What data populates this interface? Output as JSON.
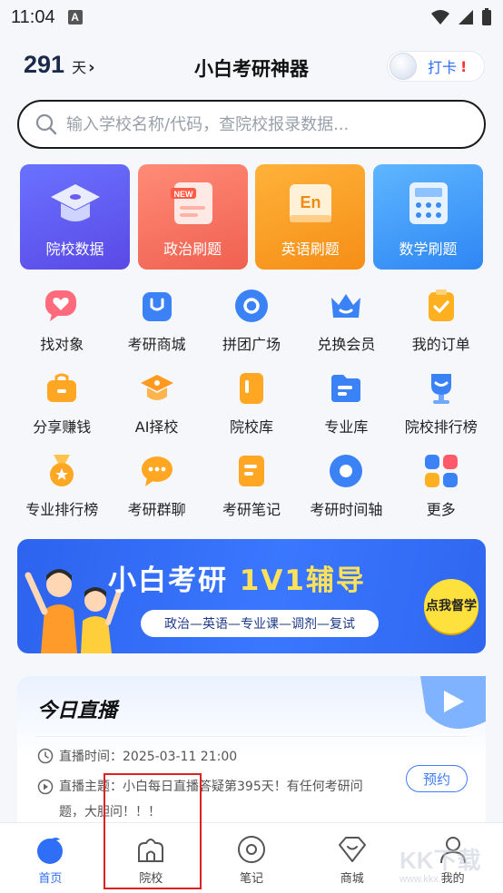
{
  "status_bar": {
    "time": "11:04",
    "notif_letter": "A"
  },
  "header": {
    "days_count": "291",
    "days_unit": "天",
    "days_chevron": "›",
    "title": "小白考研神器",
    "checkin_label": "打卡",
    "checkin_alert": "!"
  },
  "search": {
    "placeholder": "输入学校名称/代码，查院校报录数据..."
  },
  "big_cards": [
    {
      "label": "院校数据",
      "icon": "graduation-cap-icon"
    },
    {
      "label": "政治刷题",
      "icon": "new-document-icon",
      "icon_text": "NEW"
    },
    {
      "label": "英语刷题",
      "icon": "english-book-icon",
      "icon_text": "En"
    },
    {
      "label": "数学刷题",
      "icon": "calculator-icon"
    }
  ],
  "grid": [
    {
      "label": "找对象",
      "icon": "heart-chat-icon"
    },
    {
      "label": "考研商城",
      "icon": "shopping-bag-icon"
    },
    {
      "label": "拼团广场",
      "icon": "group-circle-icon"
    },
    {
      "label": "兑换会员",
      "icon": "crown-icon"
    },
    {
      "label": "我的订单",
      "icon": "order-check-icon"
    },
    {
      "label": "分享赚钱",
      "icon": "briefcase-icon"
    },
    {
      "label": "AI择校",
      "icon": "ai-cap-icon"
    },
    {
      "label": "院校库",
      "icon": "school-book-icon"
    },
    {
      "label": "专业库",
      "icon": "folder-icon"
    },
    {
      "label": "院校排行榜",
      "icon": "trophy-icon"
    },
    {
      "label": "专业排行榜",
      "icon": "medal-icon"
    },
    {
      "label": "考研群聊",
      "icon": "chat-bubble-icon"
    },
    {
      "label": "考研笔记",
      "icon": "notes-icon"
    },
    {
      "label": "考研时间轴",
      "icon": "timeline-icon"
    },
    {
      "label": "更多",
      "icon": "more-dots-icon"
    }
  ],
  "banner": {
    "title_part1": "小白考研",
    "title_part2": " 1V1辅导",
    "subtitle": "政治—英语—专业课—调剂—复试",
    "badge": "点我督学"
  },
  "live": {
    "title": "今日直播",
    "time_label": "直播时间：2025-03-11 21:00",
    "topic_label": "直播主题：小白每日直播答疑第395天！有任何考研问题，大胆问！！！",
    "reserve": "预约"
  },
  "bottom_nav": [
    {
      "label": "首页",
      "icon": "home-icon",
      "active": true
    },
    {
      "label": "院校",
      "icon": "school-icon",
      "active": false
    },
    {
      "label": "笔记",
      "icon": "notes-nav-icon",
      "active": false
    },
    {
      "label": "商城",
      "icon": "mall-icon",
      "active": false
    },
    {
      "label": "我的",
      "icon": "profile-icon",
      "active": false
    }
  ],
  "watermark": {
    "brand": "KK下载",
    "url": "www.kkx.net"
  },
  "colors": {
    "accent": "#2f6ef6",
    "highlight": "#e02020"
  }
}
